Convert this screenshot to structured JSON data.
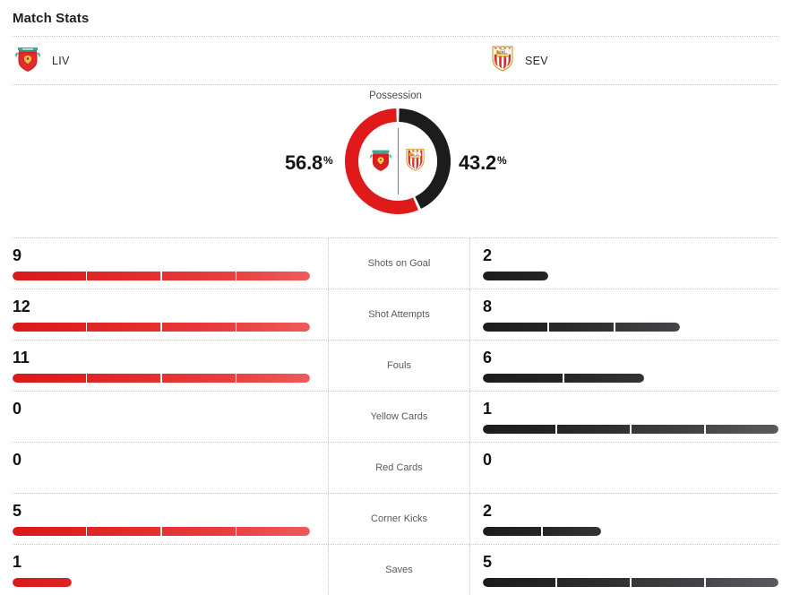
{
  "header": {
    "title": "Match Stats"
  },
  "teams": {
    "home": {
      "abbr": "LIV",
      "crest": "liverpool-crest",
      "color": "#e01a1a"
    },
    "away": {
      "abbr": "SEV",
      "crest": "sevilla-crest",
      "color": "#1c1c1e"
    }
  },
  "possession": {
    "title": "Possession",
    "home_pct": "56.8",
    "away_pct": "43.2",
    "percent_symbol": "%",
    "home_value": 56.8,
    "away_value": 43.2
  },
  "chart_data": {
    "type": "pie",
    "title": "Possession",
    "categories": [
      "LIV",
      "SEV"
    ],
    "values": [
      56.8,
      43.2
    ],
    "colors": [
      "#e01a1a",
      "#1c1c1e"
    ],
    "unit": "%",
    "legend": "inline-labels"
  },
  "stats": {
    "rows": [
      {
        "label": "Shots on Goal",
        "home": "9",
        "away": "2",
        "home_num": 9,
        "away_num": 2
      },
      {
        "label": "Shot Attempts",
        "home": "12",
        "away": "8",
        "home_num": 12,
        "away_num": 8
      },
      {
        "label": "Fouls",
        "home": "11",
        "away": "6",
        "home_num": 11,
        "away_num": 6
      },
      {
        "label": "Yellow Cards",
        "home": "0",
        "away": "1",
        "home_num": 0,
        "away_num": 1
      },
      {
        "label": "Red Cards",
        "home": "0",
        "away": "0",
        "home_num": 0,
        "away_num": 0
      },
      {
        "label": "Corner Kicks",
        "home": "5",
        "away": "2",
        "home_num": 5,
        "away_num": 2
      },
      {
        "label": "Saves",
        "home": "1",
        "away": "5",
        "home_num": 1,
        "away_num": 5
      }
    ]
  }
}
